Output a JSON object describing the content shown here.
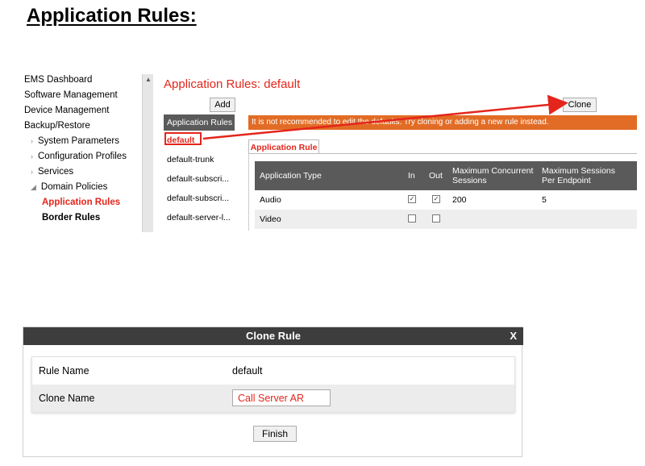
{
  "doc": {
    "heading": "Application Rules:"
  },
  "nav": {
    "items": [
      {
        "label": "EMS Dashboard"
      },
      {
        "label": "Software Management"
      },
      {
        "label": "Device Management"
      },
      {
        "label": "Backup/Restore"
      }
    ],
    "sub": [
      {
        "arrow": "›",
        "label": "System Parameters"
      },
      {
        "arrow": "›",
        "label": "Configuration Profiles"
      },
      {
        "arrow": "›",
        "label": "Services"
      },
      {
        "arrow": "◢",
        "label": "Domain Policies"
      }
    ],
    "leaves": [
      {
        "label": "Application Rules"
      },
      {
        "label": "Border Rules"
      }
    ],
    "scroll_up_arrow": "▲"
  },
  "pane": {
    "title": "Application Rules: default",
    "add_label": "Add",
    "clone_label": "Clone",
    "rules_header": "Application Rules",
    "rules": [
      "default",
      "default-trunk",
      "default-subscri...",
      "default-subscri...",
      "default-server-l..."
    ],
    "warning": "It is not recommended to edit the defaults. Try cloning or adding a new rule instead.",
    "tab_label": "Application Rule",
    "grid": {
      "headers": {
        "type": "Application Type",
        "in": "In",
        "out": "Out",
        "max_concurrent": "Maximum Concurrent Sessions",
        "max_per_endpoint": "Maximum Sessions Per Endpoint"
      },
      "rows": [
        {
          "type": "Audio",
          "in_checked": true,
          "out_checked": true,
          "max_concurrent": "200",
          "max_per_endpoint": "5"
        },
        {
          "type": "Video",
          "in_checked": false,
          "out_checked": false,
          "max_concurrent": "",
          "max_per_endpoint": ""
        }
      ],
      "check_glyph": "✓"
    }
  },
  "dialog": {
    "title": "Clone Rule",
    "close_label": "X",
    "rule_name_label": "Rule Name",
    "rule_name_value": "default",
    "clone_name_label": "Clone Name",
    "clone_name_value": "Call Server AR",
    "finish_label": "Finish"
  },
  "colors": {
    "accent": "#e4251b",
    "warning_bg": "#e26c25",
    "header_bg": "#5a5a5a",
    "dialog_title_bg": "#3d3d3d"
  }
}
